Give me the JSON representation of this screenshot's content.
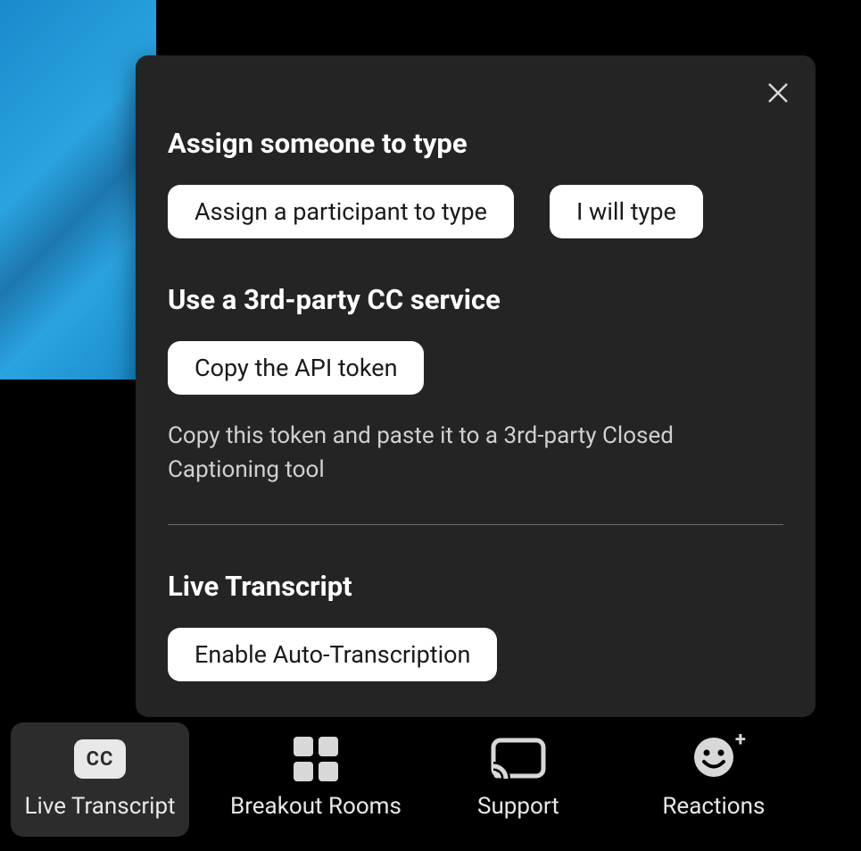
{
  "popup": {
    "section1": {
      "title": "Assign someone to type",
      "assign_participant_label": "Assign a participant to type",
      "i_will_type_label": "I will type"
    },
    "section2": {
      "title": "Use a 3rd-party CC service",
      "copy_token_label": "Copy the API token",
      "help_text": "Copy this token and paste it to a 3rd-party Closed Captioning tool"
    },
    "section3": {
      "title": "Live Transcript",
      "enable_label": "Enable Auto-Transcription"
    }
  },
  "toolbar": {
    "cc_badge": "CC",
    "live_transcript": "Live Transcript",
    "breakout_rooms": "Breakout Rooms",
    "support": "Support",
    "reactions": "Reactions"
  }
}
